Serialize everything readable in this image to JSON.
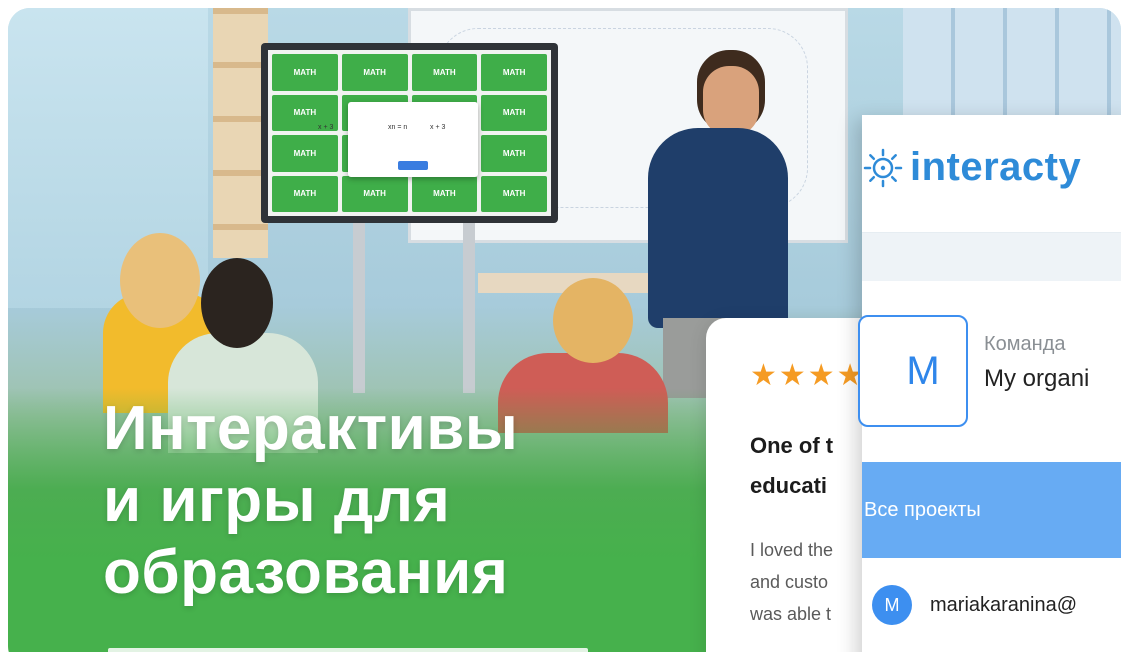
{
  "hero": {
    "title_line1": "Интерактивы",
    "title_line2": "и игры для",
    "title_line3": "образования",
    "screen_tiles": [
      "MATH",
      "MATH",
      "MATH",
      "MATH",
      "MATH",
      "",
      "",
      "MATH",
      "MATH",
      "",
      "",
      "MATH",
      "MATH",
      "MATH",
      "MATH",
      "MATH"
    ],
    "modal_left": "x + 3",
    "modal_mid": "xn = n",
    "modal_right": "x + 3"
  },
  "review": {
    "stars": "★★★★",
    "title_line1": "One of t",
    "title_line2": "educati",
    "text_line1": "I loved the",
    "text_line2": "and custo",
    "text_line3": "was able t"
  },
  "panel": {
    "logo_text": "interacty",
    "team_avatar": "M",
    "team_label": "Команда",
    "team_name": "My organi",
    "all_projects": "Все проекты",
    "user_avatar": "M",
    "user_email": "mariakaranina@"
  },
  "colors": {
    "brand_blue": "#2e8bd8",
    "accent_blue": "#67abf3",
    "green": "#46b14c",
    "star": "#f59b23"
  }
}
